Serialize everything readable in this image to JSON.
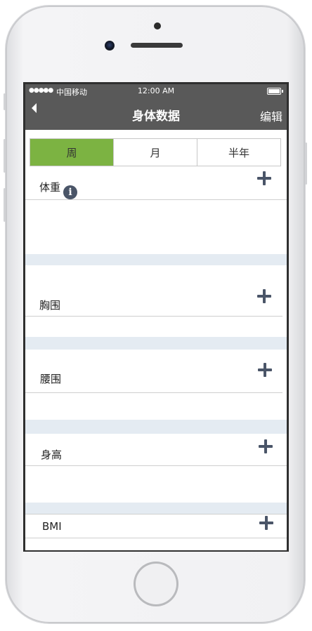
{
  "status_bar": {
    "signal": "●●●●●",
    "carrier": "中国移动",
    "time": "12:00 AM"
  },
  "nav": {
    "title": "身体数据",
    "edit_label": "编辑",
    "back_icon": "back-arrow-icon"
  },
  "segments": [
    {
      "label": "周",
      "active": true
    },
    {
      "label": "月",
      "active": false
    },
    {
      "label": "半年",
      "active": false
    }
  ],
  "sections": [
    {
      "label": "体重",
      "has_info": true,
      "info_glyph": "i"
    },
    {
      "label": "胸围"
    },
    {
      "label": "腰围"
    },
    {
      "label": "身高"
    },
    {
      "label": "BMI"
    }
  ],
  "colors": {
    "accent_green": "#7cb342",
    "header_gray": "#595959",
    "divider_band": "#e4ebf2",
    "icon_dark": "#4a5568"
  }
}
